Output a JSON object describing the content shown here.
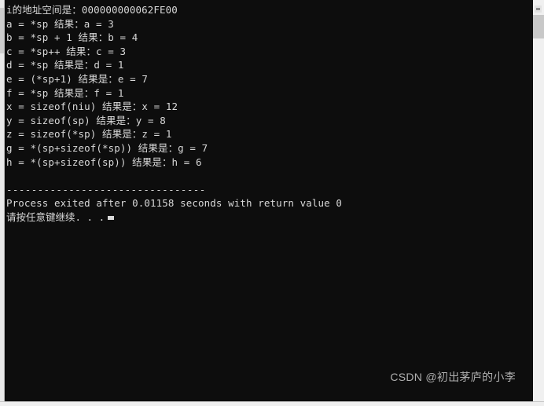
{
  "window": {
    "title": "console-output-window",
    "background_color": "#0d0d0d",
    "text_color": "#d8d8d8",
    "chrome_color": "#f0f0f0"
  },
  "terminal": {
    "lines": [
      "i的地址空间是：000000000062FE00",
      "a = *sp 结果：a = 3",
      "b = *sp + 1 结果：b = 4",
      "c = *sp++ 结果：c = 3",
      "d = *sp 结果是：d = 1",
      "e = (*sp+1) 结果是：e = 7",
      "f = *sp 结果是：f = 1",
      "x = sizeof(niu) 结果是：x = 12",
      "y = sizeof(sp) 结果是：y = 8",
      "z = sizeof(*sp) 结果是：z = 1",
      "g = *(sp+sizeof(*sp)) 结果是：g = 7",
      "h = *(sp+sizeof(sp)) 结果是：h = 6"
    ],
    "blank_line": "",
    "separator": "--------------------------------",
    "exit_message": "Process exited after 0.01158 seconds with return value 0",
    "press_key_prompt": "请按任意键继续. . ."
  },
  "watermark": {
    "text": "CSDN @初出茅庐的小李"
  }
}
